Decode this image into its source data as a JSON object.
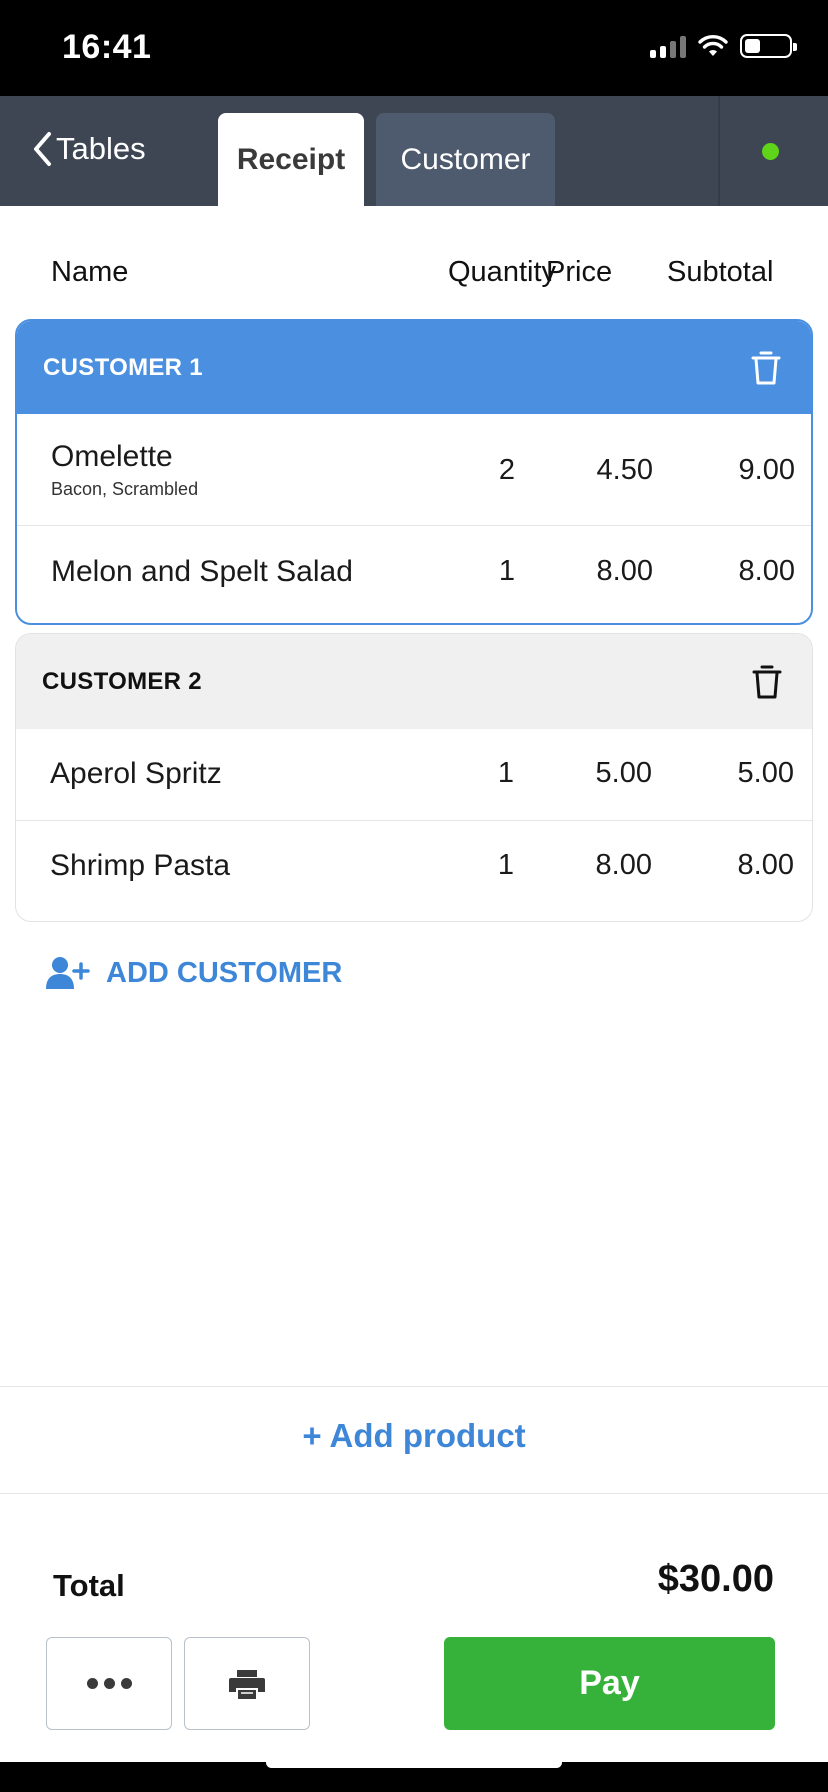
{
  "status_bar": {
    "time": "16:41",
    "battery_level": 0.35
  },
  "header": {
    "back_label": "Tables",
    "tabs": [
      {
        "label": "Receipt",
        "active": true
      },
      {
        "label": "Customer",
        "active": false
      }
    ],
    "status_color": "#5fd418"
  },
  "columns": {
    "name": "Name",
    "quantity": "Quantity",
    "price": "Price",
    "subtotal": "Subtotal"
  },
  "customers": [
    {
      "title": "CUSTOMER 1",
      "selected": true,
      "items": [
        {
          "name": "Omelette",
          "modifiers": "Bacon, Scrambled",
          "quantity": "2",
          "price": "4.50",
          "subtotal": "9.00"
        },
        {
          "name": "Melon and Spelt Salad",
          "quantity": "1",
          "price": "8.00",
          "subtotal": "8.00"
        }
      ]
    },
    {
      "title": "CUSTOMER 2",
      "selected": false,
      "items": [
        {
          "name": "Aperol Spritz",
          "quantity": "1",
          "price": "5.00",
          "subtotal": "5.00"
        },
        {
          "name": "Shrimp Pasta",
          "quantity": "1",
          "price": "8.00",
          "subtotal": "8.00"
        }
      ]
    }
  ],
  "add_customer_label": "ADD CUSTOMER",
  "add_product_label": "+ Add product",
  "total": {
    "label": "Total",
    "value": "$30.00"
  },
  "actions": {
    "pay_label": "Pay"
  },
  "colors": {
    "accent": "#4a8fe0",
    "link": "#3d86d8",
    "pay": "#36b23a",
    "header": "#3e4654"
  },
  "icons": {
    "back": "chevron-left-icon",
    "trash": "trash-icon",
    "add_customer": "user-plus-icon",
    "more": "more-dots-icon",
    "print": "printer-icon"
  }
}
